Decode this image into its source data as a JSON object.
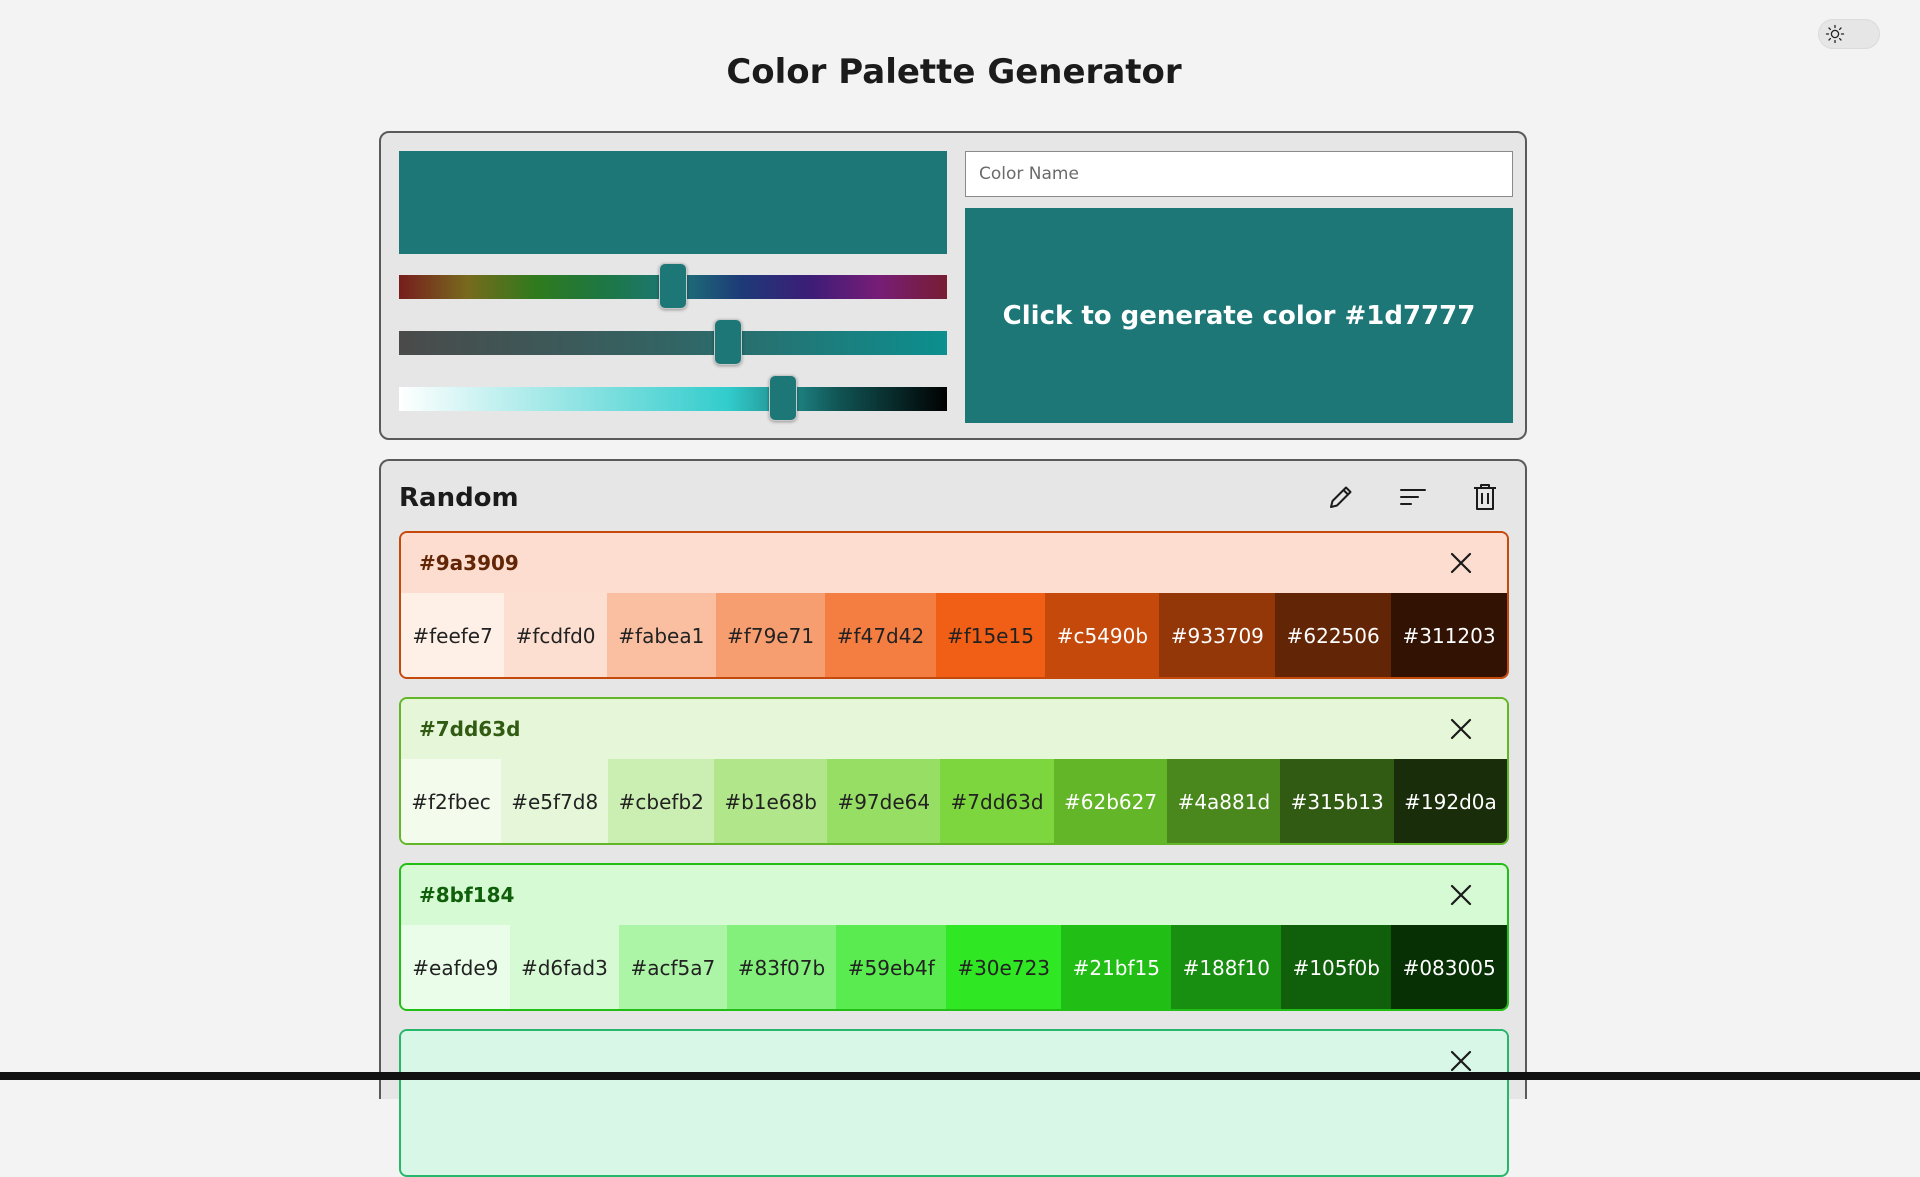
{
  "title": "Color Palette Generator",
  "theme_toggle": {
    "icon": "sun-icon"
  },
  "generator": {
    "current_color": "#1d7777",
    "name_placeholder": "Color Name",
    "generate_label": "Click to generate color #1d7777",
    "hue_value": 0.5,
    "saturation_value": 0.6,
    "lightness_value": 0.7
  },
  "list": {
    "title": "Random",
    "toolbar": {
      "edit_icon": "pencil-icon",
      "sort_icon": "sort-icon",
      "delete_icon": "trash-icon"
    }
  },
  "palettes": [
    {
      "label": "#9a3909",
      "head_bg": "#fcddd0",
      "border": "#c5490b",
      "label_color": "#622506",
      "swatches": [
        {
          "hex": "#feefe7",
          "text": "#222222"
        },
        {
          "hex": "#fcdfd0",
          "text": "#222222"
        },
        {
          "hex": "#fabea1",
          "text": "#222222"
        },
        {
          "hex": "#f79e71",
          "text": "#222222"
        },
        {
          "hex": "#f47d42",
          "text": "#222222"
        },
        {
          "hex": "#f15e15",
          "text": "#222222"
        },
        {
          "hex": "#c5490b",
          "text": "#ffffff"
        },
        {
          "hex": "#933709",
          "text": "#ffffff"
        },
        {
          "hex": "#622506",
          "text": "#ffffff"
        },
        {
          "hex": "#311203",
          "text": "#ffffff"
        }
      ]
    },
    {
      "label": "#7dd63d",
      "head_bg": "#e5f7d8",
      "border": "#62b627",
      "label_color": "#315b13",
      "swatches": [
        {
          "hex": "#f2fbec",
          "text": "#222222"
        },
        {
          "hex": "#e5f7d8",
          "text": "#222222"
        },
        {
          "hex": "#cbefb2",
          "text": "#222222"
        },
        {
          "hex": "#b1e68b",
          "text": "#222222"
        },
        {
          "hex": "#97de64",
          "text": "#222222"
        },
        {
          "hex": "#7dd63d",
          "text": "#222222"
        },
        {
          "hex": "#62b627",
          "text": "#ffffff"
        },
        {
          "hex": "#4a881d",
          "text": "#ffffff"
        },
        {
          "hex": "#315b13",
          "text": "#ffffff"
        },
        {
          "hex": "#192d0a",
          "text": "#ffffff"
        }
      ]
    },
    {
      "label": "#8bf184",
      "head_bg": "#d6fad3",
      "border": "#21bf15",
      "label_color": "#105f0b",
      "swatches": [
        {
          "hex": "#eafde9",
          "text": "#222222"
        },
        {
          "hex": "#d6fad3",
          "text": "#222222"
        },
        {
          "hex": "#acf5a7",
          "text": "#222222"
        },
        {
          "hex": "#83f07b",
          "text": "#222222"
        },
        {
          "hex": "#59eb4f",
          "text": "#222222"
        },
        {
          "hex": "#30e723",
          "text": "#222222"
        },
        {
          "hex": "#21bf15",
          "text": "#ffffff"
        },
        {
          "hex": "#188f10",
          "text": "#ffffff"
        },
        {
          "hex": "#105f0b",
          "text": "#ffffff"
        },
        {
          "hex": "#083005",
          "text": "#ffffff"
        }
      ]
    },
    {
      "label": "",
      "head_bg": "#d8f7e6",
      "border": "#27b66a",
      "label_color": "#13582f",
      "swatches": []
    }
  ]
}
